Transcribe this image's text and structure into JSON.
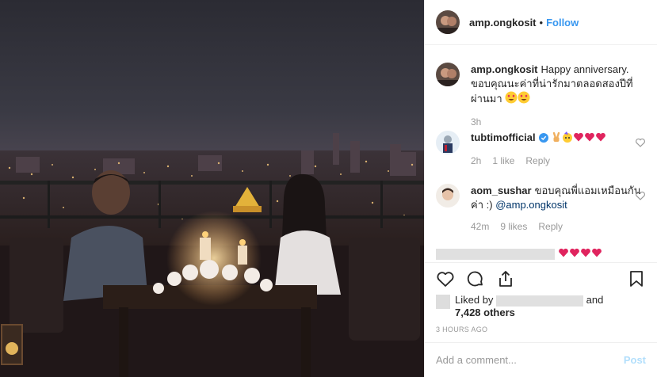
{
  "header": {
    "username": "amp.ongkosit",
    "separator": "•",
    "follow_label": "Follow"
  },
  "caption": {
    "username": "amp.ongkosit",
    "text": "Happy anniversary. ขอบคุณนะค่าที่น่ารักมาตลอดสองปีที่ผ่านมา",
    "emoji": [
      "heart-eyes-emoji",
      "heart-eyes-emoji"
    ],
    "time": "3h"
  },
  "comments": [
    {
      "username": "tubtimofficial",
      "verified": true,
      "emoji": [
        "victory-hand-emoji",
        "party-face-emoji",
        "heart-emoji",
        "heart-emoji",
        "heart-emoji"
      ],
      "time": "2h",
      "likes": "1 like",
      "reply": "Reply"
    },
    {
      "username": "aom_sushar",
      "text": "ขอบคุณพี่แอมเหมือนกันค่า :)",
      "mention": "@amp.ongkosit",
      "time": "42m",
      "likes": "9 likes",
      "reply": "Reply"
    },
    {
      "username_hidden": true,
      "emoji": [
        "heart-emoji",
        "heart-emoji",
        "heart-emoji",
        "heart-emoji"
      ]
    }
  ],
  "likes": {
    "prefix": "Liked by",
    "and": "and",
    "others": "7,428 others"
  },
  "timestamp": "3 HOURS AGO",
  "add_comment": {
    "placeholder": "Add a comment...",
    "post_label": "Post"
  },
  "colors": {
    "link": "#3897f0",
    "mention": "#003569",
    "muted": "#999999",
    "border": "#efefef",
    "heart": "#e0245e"
  }
}
